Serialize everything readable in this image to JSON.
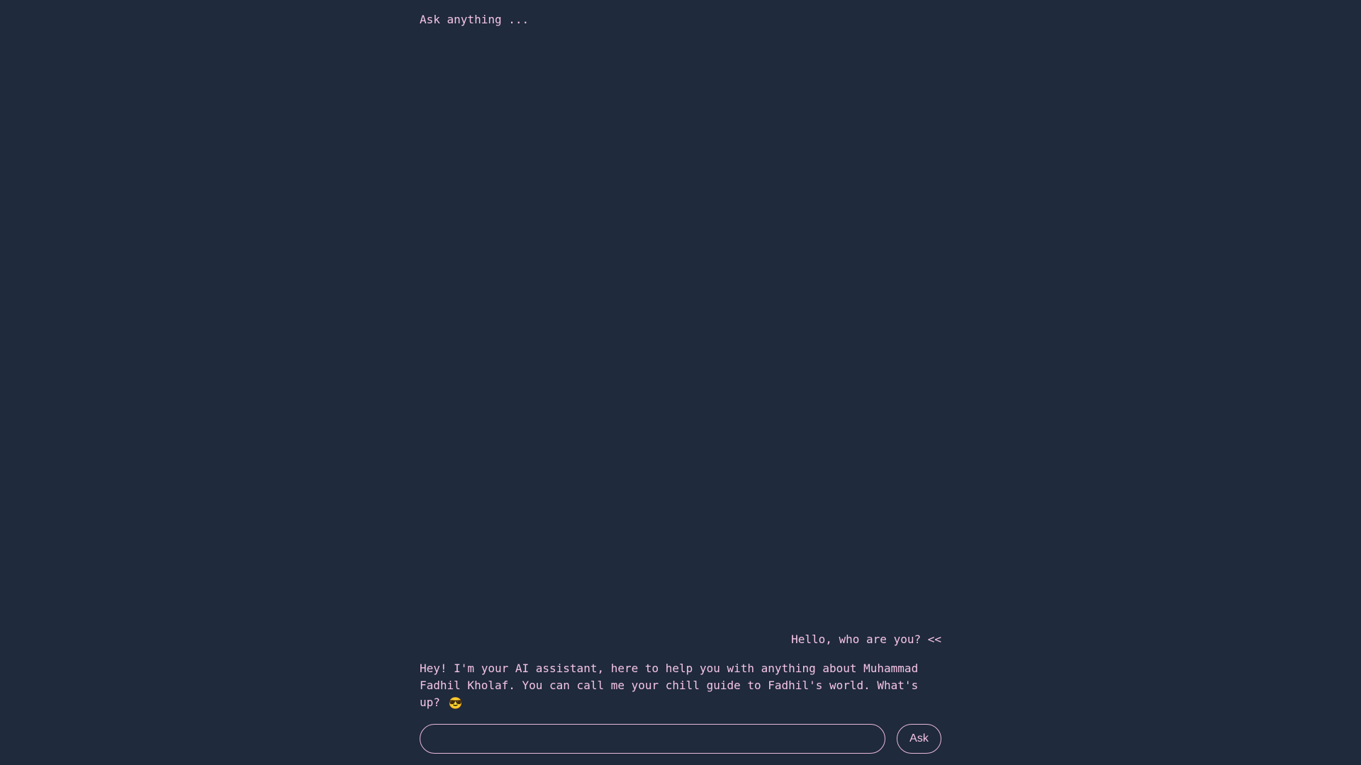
{
  "header": {
    "title": "Ask anything ..."
  },
  "chat": {
    "messages": [
      {
        "role": "user",
        "text": "Hello, who are you? <<"
      },
      {
        "role": "assistant",
        "text": "Hey! I'm your AI assistant, here to help you with anything about Muhammad Fadhil Kholaf. You can call me your chill guide to Fadhil's world. What's up?",
        "emoji": "😎"
      }
    ]
  },
  "composer": {
    "input_value": "",
    "input_placeholder": "",
    "button_label": "Ask"
  },
  "colors": {
    "background": "#1f2a3c",
    "text": "#f5c5e6",
    "border": "#e9b9da"
  }
}
